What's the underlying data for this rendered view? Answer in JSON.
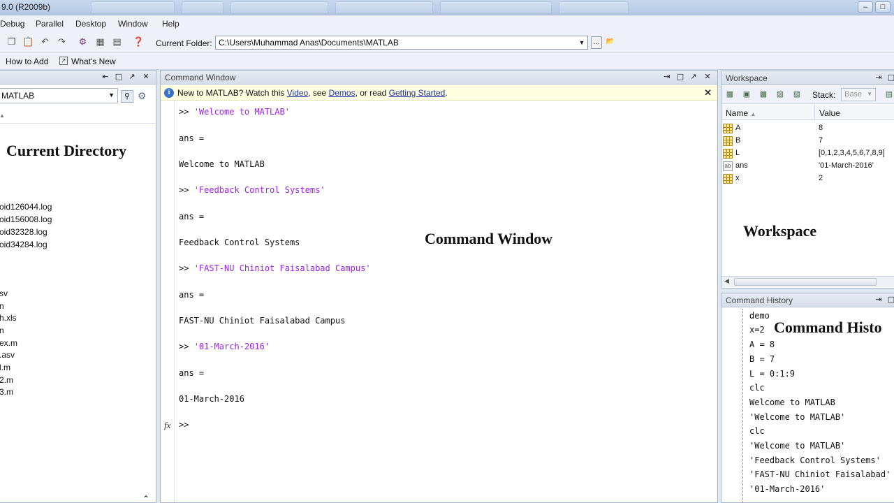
{
  "window": {
    "title": "9.0 (R2009b)"
  },
  "menu": [
    "Debug",
    "Parallel",
    "Desktop",
    "Window",
    "Help"
  ],
  "toolbar": {
    "current_folder_label": "Current Folder:",
    "current_folder_value": "C:\\Users\\Muhammad Anas\\Documents\\MATLAB"
  },
  "shortcuts": [
    "How to Add",
    "What's New"
  ],
  "current_directory": {
    "path": "MATLAB",
    "annotation": "Current Directory",
    "files_group1": [
      "oid126044.log",
      "oid156008.log",
      "oid32328.log",
      "oid34284.log"
    ],
    "files_group2": [
      "sv",
      "n",
      "h.xls",
      "n",
      "ex.m",
      ".asv",
      "l.m",
      "2.m",
      "3.m"
    ]
  },
  "command_window": {
    "title": "Command Window",
    "notice": {
      "prefix": "New to MATLAB? Watch this ",
      "video": "Video",
      "mid1": ", see ",
      "demos": "Demos",
      "mid2": ", or read ",
      "getting_started": "Getting Started",
      "suffix": "."
    },
    "annotation": "Command Window",
    "prompt": ">>",
    "ans": "ans =",
    "entries": [
      {
        "input": "'Welcome to MATLAB'",
        "output": "Welcome to MATLAB"
      },
      {
        "input": "'Feedback Control Systems'",
        "output": "Feedback Control Systems"
      },
      {
        "input": "'FAST-NU Chiniot Faisalabad Campus'",
        "output": "FAST-NU Chiniot Faisalabad Campus"
      },
      {
        "input": "'01-March-2016'",
        "output": "01-March-2016"
      }
    ],
    "fx_label": "fx"
  },
  "workspace": {
    "title": "Workspace",
    "stack_label": "Stack:",
    "stack_value": "Base",
    "col_name": "Name",
    "col_value": "Value",
    "variables": [
      {
        "name": "A",
        "value": "8",
        "type": "matrix"
      },
      {
        "name": "B",
        "value": "7",
        "type": "matrix"
      },
      {
        "name": "L",
        "value": "[0,1,2,3,4,5,6,7,8,9]",
        "type": "matrix"
      },
      {
        "name": "ans",
        "value": "'01-March-2016'",
        "type": "string"
      },
      {
        "name": "x",
        "value": "2",
        "type": "matrix"
      }
    ],
    "annotation": "Workspace"
  },
  "command_history": {
    "title": "Command History",
    "annotation": "Command Histo",
    "lines": [
      {
        "text": "demo",
        "kind": "plain"
      },
      {
        "text": "x=2",
        "kind": "plain"
      },
      {
        "text": "A = 8",
        "kind": "plain"
      },
      {
        "text": "B = 7",
        "kind": "plain"
      },
      {
        "text": "L = 0:1:9",
        "kind": "plain"
      },
      {
        "text": "clc",
        "kind": "plain"
      },
      {
        "text": "Welcome to MATLAB",
        "kind": "mixed"
      },
      {
        "text": "'Welcome to MATLAB'",
        "kind": "string"
      },
      {
        "text": "clc",
        "kind": "plain"
      },
      {
        "text": "'Welcome to MATLAB'",
        "kind": "string"
      },
      {
        "text": "'Feedback Control Systems'",
        "kind": "string"
      },
      {
        "text": "'FAST-NU Chiniot Faisalabad'",
        "kind": "string"
      },
      {
        "text": "'01-March-2016'",
        "kind": "string"
      }
    ]
  },
  "colors": {
    "string": "#a020f0",
    "link": "#1a2fa8",
    "notice_bg": "#ffffe1"
  }
}
